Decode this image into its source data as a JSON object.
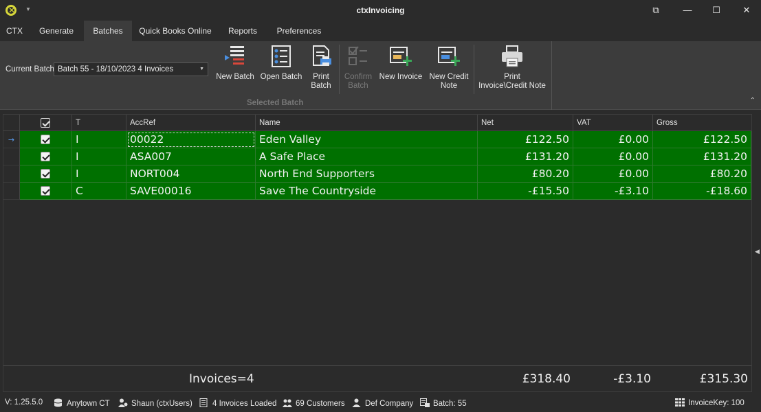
{
  "window": {
    "title": "ctxInvoicing",
    "controls": {
      "restore": "⧉",
      "minimize": "—",
      "maximize": "☐",
      "close": "✕"
    }
  },
  "tabs": [
    {
      "label": "CTX"
    },
    {
      "label": "Generate"
    },
    {
      "label": "Batches",
      "active": true
    },
    {
      "label": "Quick Books Online"
    },
    {
      "label": "Reports"
    },
    {
      "label": "Preferences"
    }
  ],
  "ribbon": {
    "current_batch_label": "Current Batch",
    "current_batch_value": "Batch 55 - 18/10/2023 4 Invoices",
    "buttons": {
      "new_batch": "New Batch",
      "open_batch": "Open Batch",
      "print_batch_1": "Print",
      "print_batch_2": "Batch",
      "confirm_batch_1": "Confirm",
      "confirm_batch_2": "Batch",
      "new_invoice": "New Invoice",
      "new_credit_note_1": "New Credit",
      "new_credit_note_2": "Note",
      "print_invoice_1": "Print",
      "print_invoice_2": "Invoice\\Credit Note"
    },
    "group_label": "Selected Batch"
  },
  "grid": {
    "columns": [
      "T",
      "AccRef",
      "Name",
      "Net",
      "VAT",
      "Gross"
    ],
    "rows": [
      {
        "checked": true,
        "type": "I",
        "accref": "00022",
        "name": "Eden Valley",
        "net": "£122.50",
        "vat": "£0.00",
        "gross": "£122.50"
      },
      {
        "checked": true,
        "type": "I",
        "accref": "ASA007",
        "name": "A Safe Place",
        "net": "£131.20",
        "vat": "£0.00",
        "gross": "£131.20"
      },
      {
        "checked": true,
        "type": "I",
        "accref": "NORT004",
        "name": "North End Supporters",
        "net": "£80.20",
        "vat": "£0.00",
        "gross": "£80.20"
      },
      {
        "checked": true,
        "type": "C",
        "accref": "SAVE00016",
        "name": "Save The Countryside",
        "net": "-£15.50",
        "vat": "-£3.10",
        "gross": "-£18.60"
      }
    ],
    "row_indicator": "→",
    "footer": {
      "count": "Invoices=4",
      "net": "£318.40",
      "vat": "-£3.10",
      "gross": "£315.30"
    }
  },
  "status": {
    "version": "V: 1.25.5.0",
    "database": "Anytown CT",
    "user": "Shaun (ctxUsers)",
    "loaded": "4 Invoices Loaded",
    "customers": "69 Customers",
    "company": "Def Company",
    "batch": "Batch: 55",
    "invoice_key": "InvoiceKey: 100"
  },
  "colors": {
    "row_bg": "#007000",
    "window_bg": "#2b2b2b",
    "ribbon_bg": "#3c3c3c",
    "accent_red": "#d9473b",
    "accent_blue": "#4a8fe0",
    "accent_green": "#3aa858"
  }
}
